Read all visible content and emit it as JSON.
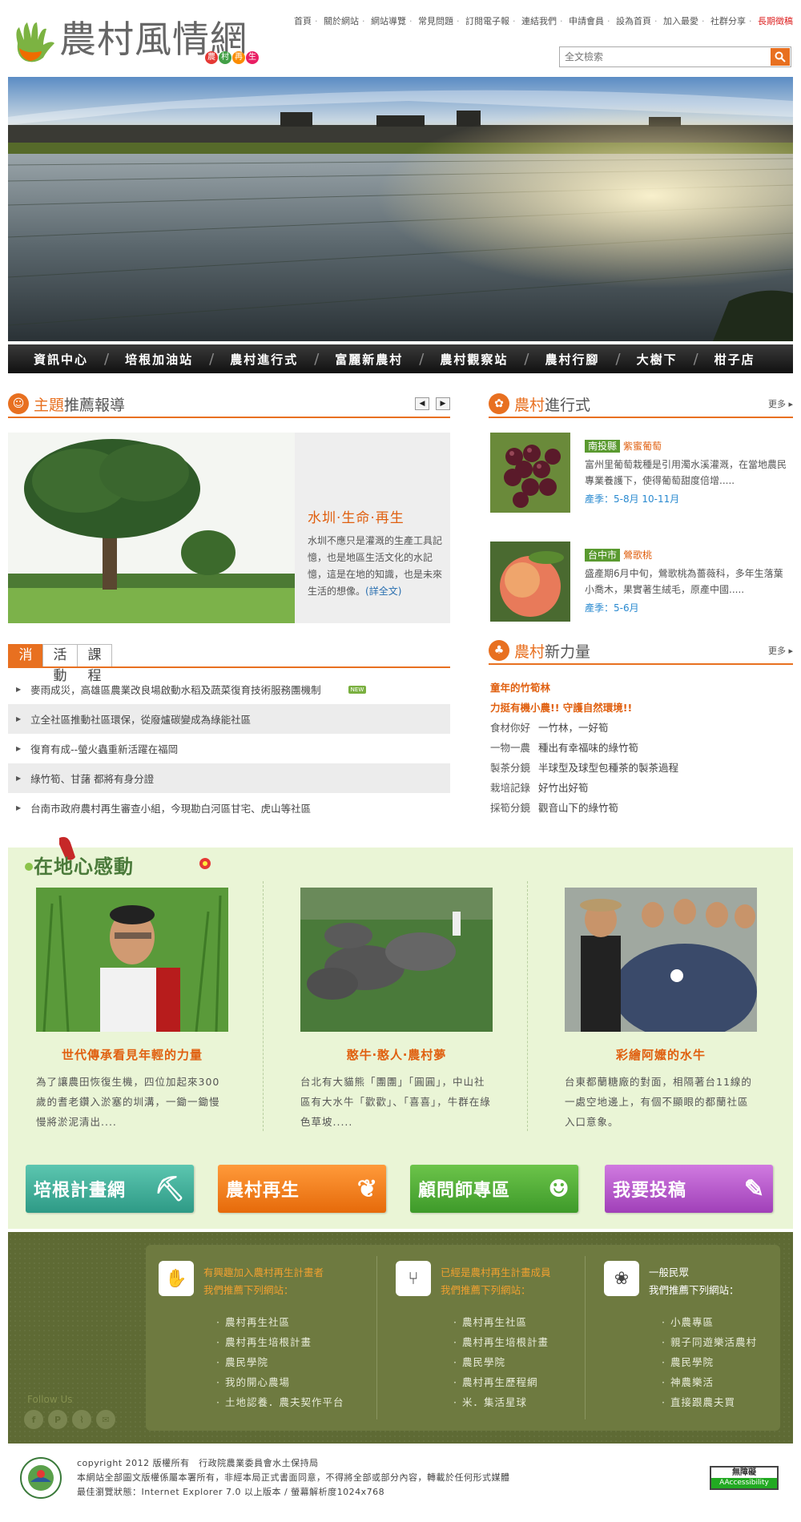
{
  "header": {
    "logo_title": "農村風情網",
    "logo_sub": [
      "農",
      "村",
      "再",
      "生"
    ],
    "top_links": [
      "首頁",
      "關於網站",
      "網站導覽",
      "常見問題",
      "訂閱電子報",
      "連結我們",
      "申請會員",
      "設為首頁",
      "加入最愛",
      "社群分享"
    ],
    "top_highlight": "長期徵稿",
    "search_placeholder": "全文檢索"
  },
  "main_nav": [
    "資訊中心",
    "培根加油站",
    "農村進行式",
    "富麗新農村",
    "農村觀察站",
    "農村行腳",
    "大樹下",
    "柑子店"
  ],
  "featured": {
    "title_a": "主題",
    "title_b": "推薦報導",
    "headline": "水圳‧生命‧再生",
    "body": "水圳不應只是灌溉的生產工具記憶，也是地區生活文化的水記憶，這是在地的知識，也是未來生活的想像。",
    "more_link": "(詳全文)"
  },
  "village": {
    "title_a": "農村",
    "title_b": "進行式",
    "more": "更多",
    "items": [
      {
        "county": "南投縣",
        "name": "紫蜜葡萄",
        "desc": "富州里葡萄栽種是引用濁水溪灌溉，在當地農民專業養護下，使得葡萄甜度倍增.....",
        "season": "產季：5-8月 10-11月"
      },
      {
        "county": "台中市",
        "name": "鶯歌桃",
        "desc": "盛產期6月中旬，鶯歌桃為薔薇科，多年生落葉小喬木，果實著生絨毛，原產中國.....",
        "season": "產季：5-6月"
      }
    ]
  },
  "news_tabs": [
    "消息",
    "活動",
    "課程"
  ],
  "news": [
    {
      "text": "麥雨成災，高雄區農業改良場啟動水稻及蔬菜復育技術服務團機制",
      "new": "NEW"
    },
    {
      "text": "立全社區推動社區環保，從廢爐碳變成為綠能社區"
    },
    {
      "text": "復育有成--螢火蟲重新活躍在福岡"
    },
    {
      "text": "綠竹筍、甘藷 都將有身分證"
    },
    {
      "text": "台南市政府農村再生審查小組，今現勘白河區甘宅、虎山等社區"
    }
  ],
  "power": {
    "title_a": "農村",
    "title_b": "新力量",
    "more": "更多",
    "headline1": "童年的竹筍林",
    "headline2": "力挺有機小農!! 守護自然環境!!",
    "items": [
      {
        "k": "食材你好",
        "v": "一竹林，一好筍"
      },
      {
        "k": "一物一農",
        "v": "種出有幸福味的綠竹筍"
      },
      {
        "k": "製茶分鏡",
        "v": "半球型及球型包種茶的製茶過程"
      },
      {
        "k": "栽培記錄",
        "v": "好竹出好筍"
      },
      {
        "k": "採筍分鏡",
        "v": "觀音山下的綠竹筍"
      }
    ]
  },
  "local": {
    "title": "在地心感動",
    "cards": [
      {
        "title": "世代傳承看見年輕的力量",
        "text": "為了讓農田恢復生機，四位加起來300歲的耆老鑽入淤塞的圳溝，一鋤一鋤慢慢將淤泥清出....",
        "image": "young-farmer-photo"
      },
      {
        "title": "憨牛‧憨人‧農村夢",
        "text": "台北有大貓熊「團團」「圓圓」，中山社區有大水牛「歡歡」、「喜喜」，牛群在綠色草坡.....",
        "image": "water-buffalo-photo"
      },
      {
        "title": "彩繪阿嬤的水牛",
        "text": "台東都蘭糖廠的對面，相隔著台11線的一處空地邊上，有個不顯眼的都蘭社區入口意象。",
        "image": "painted-buffalo-photo"
      }
    ]
  },
  "buttons": [
    {
      "label": "培根計畫網",
      "color": "#3fae9a"
    },
    {
      "label": "農村再生",
      "color": "#ef7a18"
    },
    {
      "label": "顧問師專區",
      "color": "#4aa838"
    },
    {
      "label": "我要投稿",
      "color": "#b050c8"
    }
  ],
  "footer_cols": [
    {
      "h1": "有興趣加入農村再生計畫者",
      "h2": "我們推薦下列網站：",
      "links": [
        "農村再生社區",
        "農村再生培根計畫",
        "農民學院",
        "我的開心農場",
        "土地認養．農夫契作平台"
      ]
    },
    {
      "h1": "已經是農村再生計畫成員",
      "h2": "我們推薦下列網站：",
      "links": [
        "農村再生社區",
        "農村再生培根計畫",
        "農民學院",
        "農村再生歷程網",
        "米．集活星球"
      ]
    },
    {
      "h1": "一般民眾",
      "h2": "我們推薦下列網站：",
      "links": [
        "小農專區",
        "親子同遊樂活農村",
        "農民學院",
        "神農樂活",
        "直接跟農夫買"
      ]
    }
  ],
  "follow": "Follow Us",
  "social": [
    "f",
    "P",
    "rss",
    "mail"
  ],
  "copyright": [
    "copyright 2012 版權所有　行政院農業委員會水土保持局",
    "本網站全部圖文版權係屬本署所有，非經本局正式書面同意，不得將全部或部分內容，轉載於任何形式媒體",
    "最佳瀏覽狀態：Internet Explorer 7.0 以上版本 / 螢幕解析度1024x768"
  ],
  "accessibility": {
    "top": "無障礙",
    "bottom": "AAccessibility"
  }
}
